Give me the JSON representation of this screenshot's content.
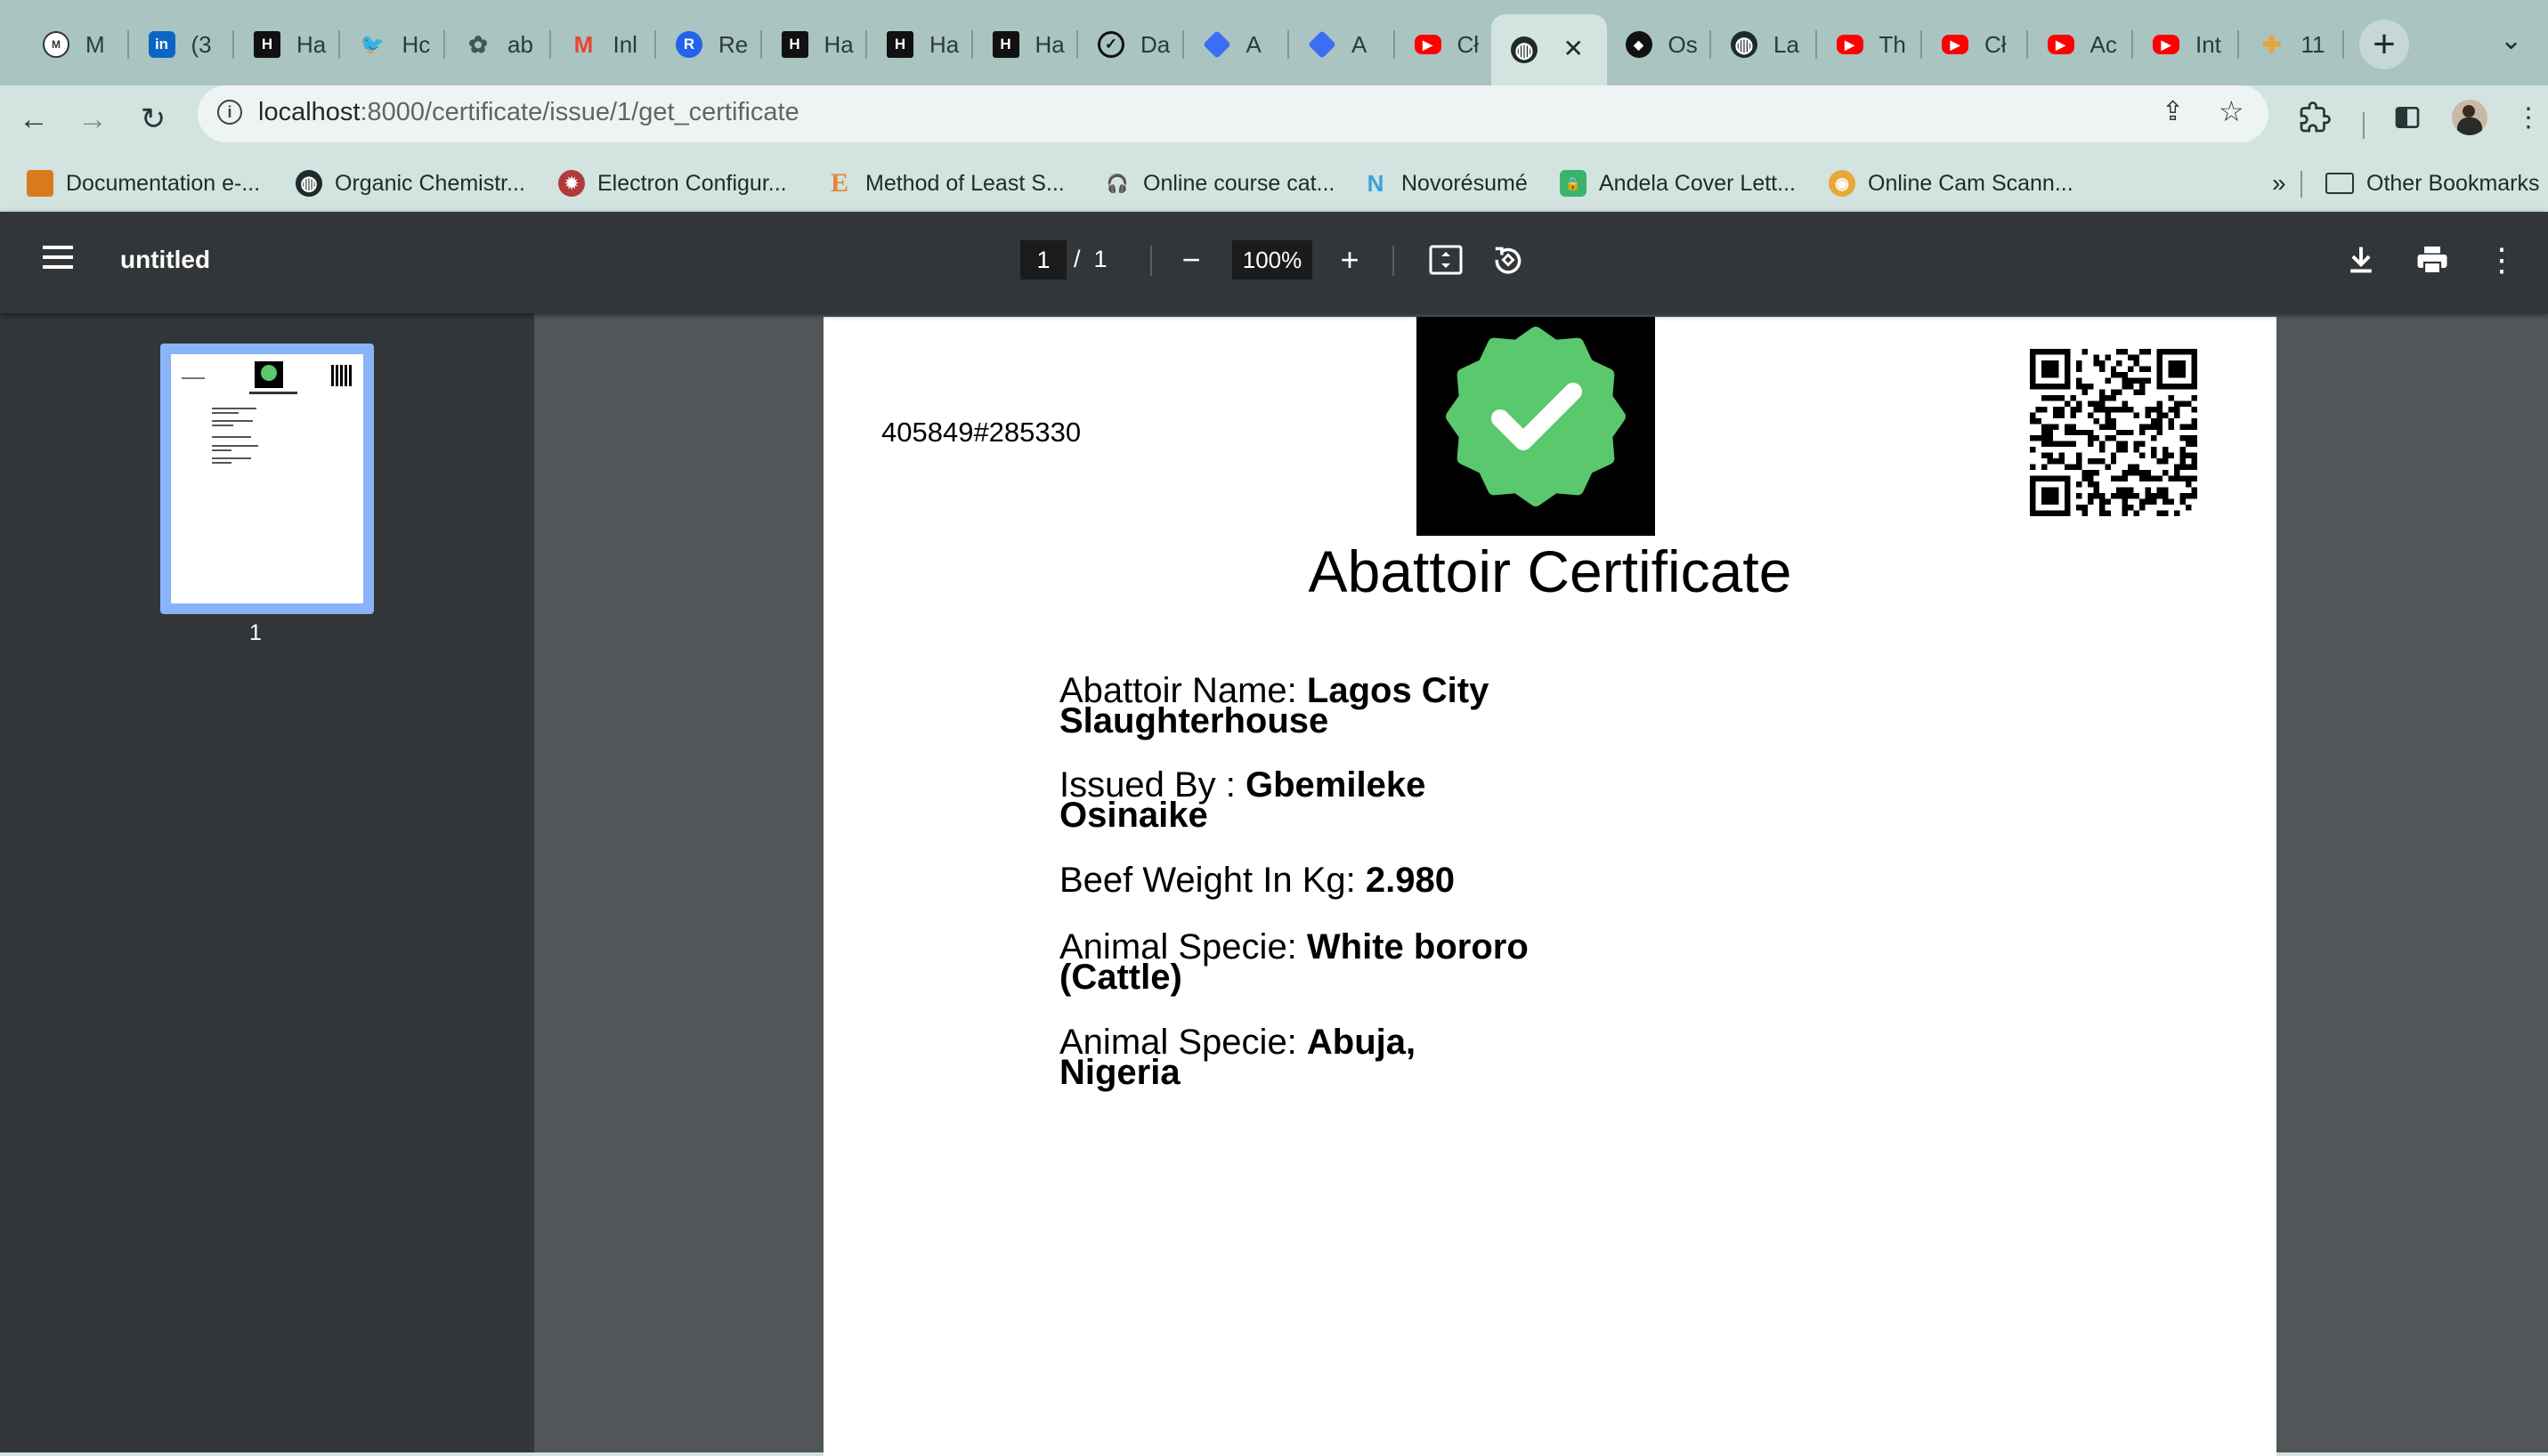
{
  "browser": {
    "tabs": [
      {
        "title": "M",
        "icon": "medium-icon",
        "color": "#333333"
      },
      {
        "title": "(3",
        "icon": "linkedin-icon",
        "color": "#0a66c2"
      },
      {
        "title": "Ha",
        "icon": "hackerrank-icon",
        "color": "#111111"
      },
      {
        "title": "Hc",
        "icon": "twitter-icon",
        "color": "#1d9bf0"
      },
      {
        "title": "ab",
        "icon": "chatgpt-icon",
        "color": "#5e7a76"
      },
      {
        "title": "Inl",
        "icon": "gmail-icon",
        "color": "#ea4335"
      },
      {
        "title": "Re",
        "icon": "remote-icon",
        "color": "#2463eb"
      },
      {
        "title": "Ha",
        "icon": "hackerrank-icon",
        "color": "#111111"
      },
      {
        "title": "Ha",
        "icon": "hackerrank-icon",
        "color": "#111111"
      },
      {
        "title": "Ha",
        "icon": "hackerrank-icon",
        "color": "#111111"
      },
      {
        "title": "Da",
        "icon": "check-circle-icon",
        "color": "#111111"
      },
      {
        "title": "A",
        "icon": "diamond-icon",
        "color": "#3b6ef5"
      },
      {
        "title": "A",
        "icon": "diamond-icon",
        "color": "#3b6ef5"
      },
      {
        "title": "Cł",
        "icon": "youtube-icon",
        "color": "#ff0000"
      },
      {
        "title": "",
        "icon": "globe-icon",
        "color": "#1e2b2a",
        "active": true
      },
      {
        "title": "Os",
        "icon": "github-icon",
        "color": "#111111"
      },
      {
        "title": "La",
        "icon": "globe-icon",
        "color": "#1e2b2a"
      },
      {
        "title": "Th",
        "icon": "youtube-icon",
        "color": "#ff0000"
      },
      {
        "title": "Cł",
        "icon": "youtube-icon",
        "color": "#ff0000"
      },
      {
        "title": "Ac",
        "icon": "youtube-icon",
        "color": "#ff0000"
      },
      {
        "title": "Int",
        "icon": "youtube-icon",
        "color": "#ff0000"
      },
      {
        "title": "11",
        "icon": "slack-icon",
        "color": "#e8a33a"
      }
    ],
    "url_host": "localhost",
    "url_rest": ":8000/certificate/issue/1/get_certificate",
    "bookmarks": [
      {
        "label": "Documentation e-...",
        "icon": "bookmark-favicon-icon",
        "color": "#d97a1e"
      },
      {
        "label": "Organic Chemistr...",
        "icon": "globe-icon",
        "color": "#1e2b2a"
      },
      {
        "label": "Electron Configur...",
        "icon": "electron-icon",
        "color": "#b23a3a"
      },
      {
        "label": "Method of Least S...",
        "icon": "letter-e-icon",
        "color": "#e08a3c"
      },
      {
        "label": "Online course cat...",
        "icon": "headphones-icon",
        "color": "#222222"
      },
      {
        "label": "Novorésumé",
        "icon": "novoresume-icon",
        "color": "#3aa0d8"
      },
      {
        "label": "Andela Cover Lett...",
        "icon": "lock-doc-icon",
        "color": "#3bb36b"
      },
      {
        "label": "Online Cam Scann...",
        "icon": "scanner-icon",
        "color": "#e6a93a"
      }
    ],
    "bookmarks_overflow": "»",
    "other_bookmarks": "Other Bookmarks"
  },
  "pdf": {
    "title": "untitled",
    "page_current": "1",
    "page_sep": "/",
    "page_total": "1",
    "zoom": "100%",
    "thumb_label": "1"
  },
  "certificate": {
    "id": "405849#285330",
    "title": "Abattoir Certificate",
    "fields": [
      {
        "label": "Abattoir Name: ",
        "value_l1": "Lagos City",
        "value_l2": "Slaughterhouse"
      },
      {
        "label": "Issued By : ",
        "value_l1": "Gbemileke",
        "value_l2": "Osinaike"
      },
      {
        "label": "Beef Weight In Kg: ",
        "value_l1": "2.980",
        "value_l2": ""
      },
      {
        "label": "Animal Specie: ",
        "value_l1": "White bororo",
        "value_l2": "(Cattle)"
      },
      {
        "label": "Animal Specie: ",
        "value_l1": "Abuja,",
        "value_l2": "Nigeria"
      }
    ],
    "badge_color": "#5ac86c"
  }
}
